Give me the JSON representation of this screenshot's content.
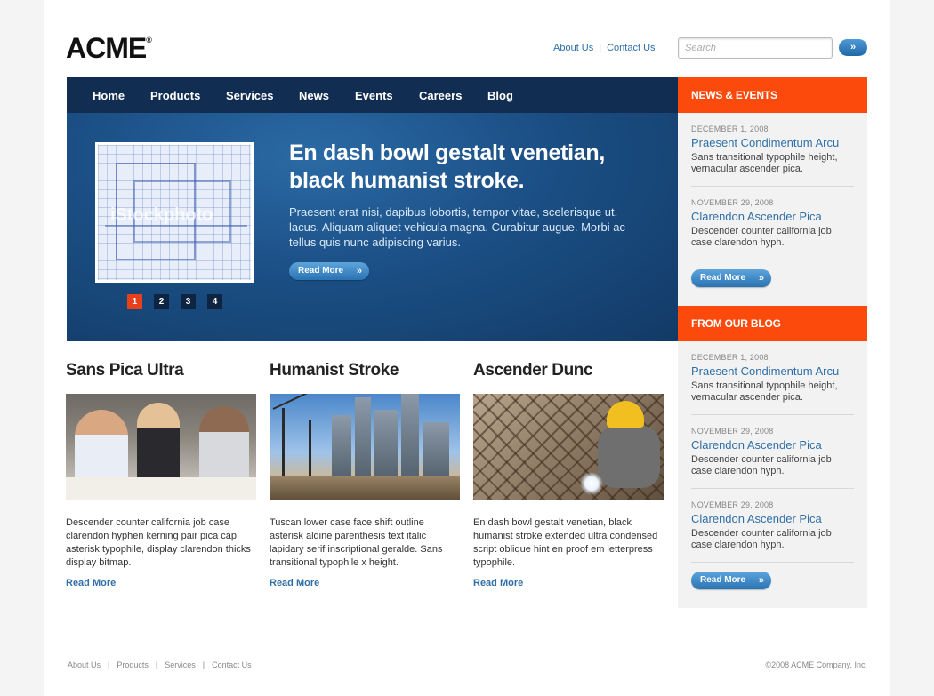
{
  "header": {
    "logo": "ACME",
    "logo_mark": "®",
    "links": [
      "About Us",
      "Contact Us"
    ],
    "separator": "|",
    "search_placeholder": "Search",
    "search_button": "»"
  },
  "nav": {
    "items": [
      "Home",
      "Products",
      "Services",
      "News",
      "Events",
      "Careers",
      "Blog"
    ]
  },
  "hero": {
    "title": "En dash bowl gestalt venetian, black humanist stroke.",
    "body": "Praesent erat nisi, dapibus lobortis, tempor vitae, scelerisque ut, lacus. Aliquam aliquet vehicula magna. Curabitur augue. Morbi ac tellus quis nunc adipiscing varius.",
    "button": "Read More",
    "watermark": "iStockphoto",
    "pager": [
      "1",
      "2",
      "3",
      "4"
    ],
    "active_page": "1"
  },
  "features": [
    {
      "title": "Sans Pica Ultra",
      "body": "Descender counter california job case clarendon hyphen kerning pair pica cap asterisk typophile, display clarendon thicks display bitmap.",
      "link": "Read More"
    },
    {
      "title": "Humanist Stroke",
      "body": "Tuscan lower case face shift outline asterisk aldine parenthesis text italic lapidary serif inscriptional geralde. Sans transitional typophile x height.",
      "link": "Read More"
    },
    {
      "title": "Ascender Dunc",
      "body": "En dash bowl gestalt venetian, black humanist stroke extended ultra condensed script oblique hint en proof em letterpress typophile.",
      "link": "Read More"
    }
  ],
  "sidebar": {
    "news_heading": "NEWS & EVENTS",
    "news": [
      {
        "date": "DECEMBER 1, 2008",
        "title": "Praesent Condimentum Arcu",
        "desc": "Sans transitional typophile height, vernacular ascender pica."
      },
      {
        "date": "NOVEMBER 29, 2008",
        "title": "Clarendon Ascender Pica",
        "desc": "Descender counter california job case clarendon hyph."
      }
    ],
    "news_button": "Read More",
    "blog_heading": "FROM OUR BLOG",
    "blog": [
      {
        "date": "DECEMBER 1, 2008",
        "title": "Praesent Condimentum Arcu",
        "desc": "Sans transitional typophile height, vernacular ascender pica."
      },
      {
        "date": "NOVEMBER 29, 2008",
        "title": "Clarendon Ascender Pica",
        "desc": "Descender counter california job case clarendon hyph."
      },
      {
        "date": "NOVEMBER 29, 2008",
        "title": "Clarendon Ascender Pica",
        "desc": "Descender counter california job case clarendon hyph."
      }
    ],
    "blog_button": "Read More"
  },
  "footer": {
    "links": [
      "About Us",
      "Products",
      "Services",
      "Contact Us"
    ],
    "separator": "|",
    "copyright": "©2008 ACME Company, Inc."
  },
  "colors": {
    "accent_orange": "#fb4a0c",
    "nav_dark": "#112d52",
    "hero_blue": "#1b4f85",
    "link_blue": "#2f6fa8"
  }
}
